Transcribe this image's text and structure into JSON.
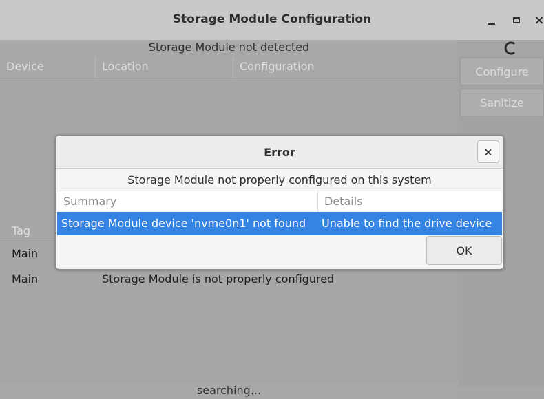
{
  "window": {
    "title": "Storage Module Configuration",
    "controls": {
      "minimize": "minimize-icon",
      "maximize": "maximize-icon",
      "close": "×"
    }
  },
  "status": {
    "message": "Storage Module not detected",
    "spinner_icon": "spinner-icon"
  },
  "table": {
    "columns": [
      "Device",
      "Location",
      "Configuration"
    ]
  },
  "side_buttons": {
    "configure": "Configure",
    "sanitize": "Sanitize"
  },
  "log": {
    "tag_header": "Tag",
    "rows": [
      {
        "tag": "Main",
        "message": ""
      },
      {
        "tag": "Main",
        "message": "Storage Module is not properly configured"
      }
    ]
  },
  "statusbar": {
    "text": "searching..."
  },
  "dialog": {
    "title": "Error",
    "close": "×",
    "message": "Storage Module not properly configured on this system",
    "columns": [
      "Summary",
      "Details"
    ],
    "rows": [
      {
        "summary": "Storage Module device 'nvme0n1' not found",
        "details": "Unable to find the drive device"
      }
    ],
    "ok_label": "OK",
    "selection_color": "#3584e4"
  }
}
